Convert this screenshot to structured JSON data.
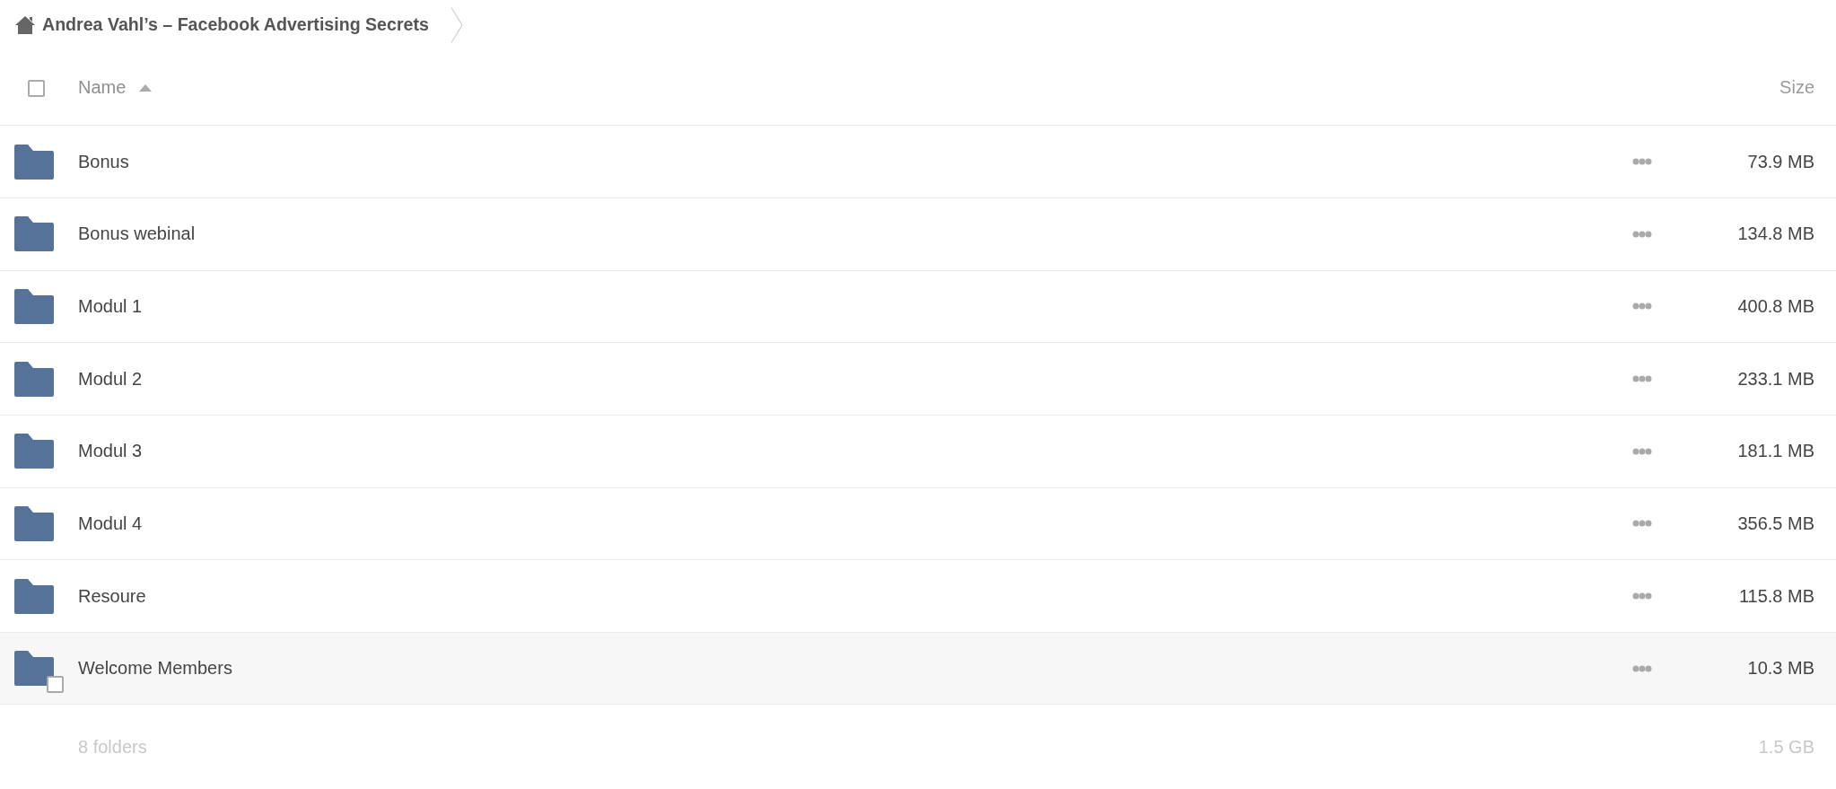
{
  "breadcrumb": {
    "items": [
      {
        "label": "Andrea Vahl’s – Facebook Advertising Secrets"
      }
    ]
  },
  "table": {
    "select_all": {
      "checked": false
    },
    "columns": [
      {
        "label": "Name",
        "sorted": true,
        "descending": false
      },
      {
        "label": "Size",
        "sorted": false
      }
    ],
    "rows": [
      {
        "name": "Bonus",
        "size": "73.9 MB",
        "highlighted": false,
        "checked": false
      },
      {
        "name": "Bonus webinal",
        "size": "134.8 MB",
        "highlighted": false,
        "checked": false
      },
      {
        "name": "Modul 1",
        "size": "400.8 MB",
        "highlighted": false,
        "checked": false
      },
      {
        "name": "Modul 2",
        "size": "233.1 MB",
        "highlighted": false,
        "checked": false
      },
      {
        "name": "Modul 3",
        "size": "181.1 MB",
        "highlighted": false,
        "checked": false
      },
      {
        "name": "Modul 4",
        "size": "356.5 MB",
        "highlighted": false,
        "checked": false
      },
      {
        "name": "Resoure",
        "size": "115.8 MB",
        "highlighted": false,
        "checked": false
      },
      {
        "name": "Welcome Members",
        "size": "10.3 MB",
        "highlighted": true,
        "checked": false
      }
    ]
  },
  "footer": {
    "count": "8 folders",
    "total": "1.5 GB"
  }
}
